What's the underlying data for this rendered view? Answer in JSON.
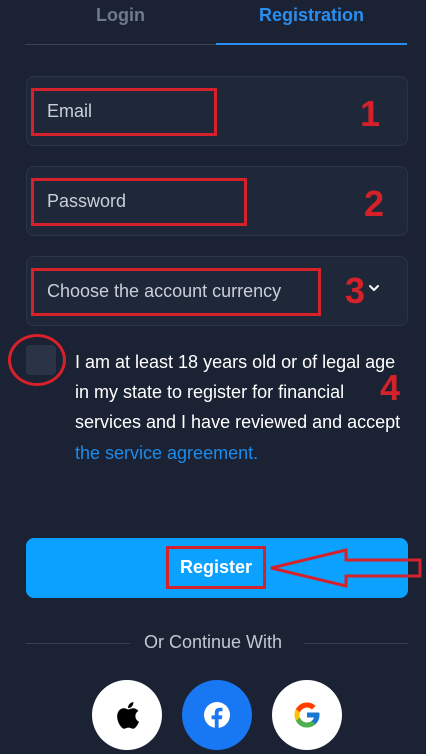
{
  "tabs": {
    "login": "Login",
    "registration": "Registration"
  },
  "form": {
    "email_placeholder": "Email",
    "password_placeholder": "Password",
    "currency_placeholder": "Choose the account currency",
    "terms_text": "I am at least 18 years old or of legal age in my state to register for financial services and I have reviewed and accept",
    "terms_link": "the service agreement.",
    "register_label": "Register"
  },
  "social": {
    "heading": "Or Continue With",
    "providers": [
      "apple-icon",
      "facebook-icon",
      "google-icon"
    ]
  },
  "annotations": {
    "step1": "1",
    "step2": "2",
    "step3": "3",
    "step4": "4"
  },
  "colors": {
    "background": "#1a2233",
    "accent": "#0aa1ff",
    "tab_active": "#2a8ef0",
    "annotation": "#d4212a",
    "facebook": "#1877f2"
  }
}
